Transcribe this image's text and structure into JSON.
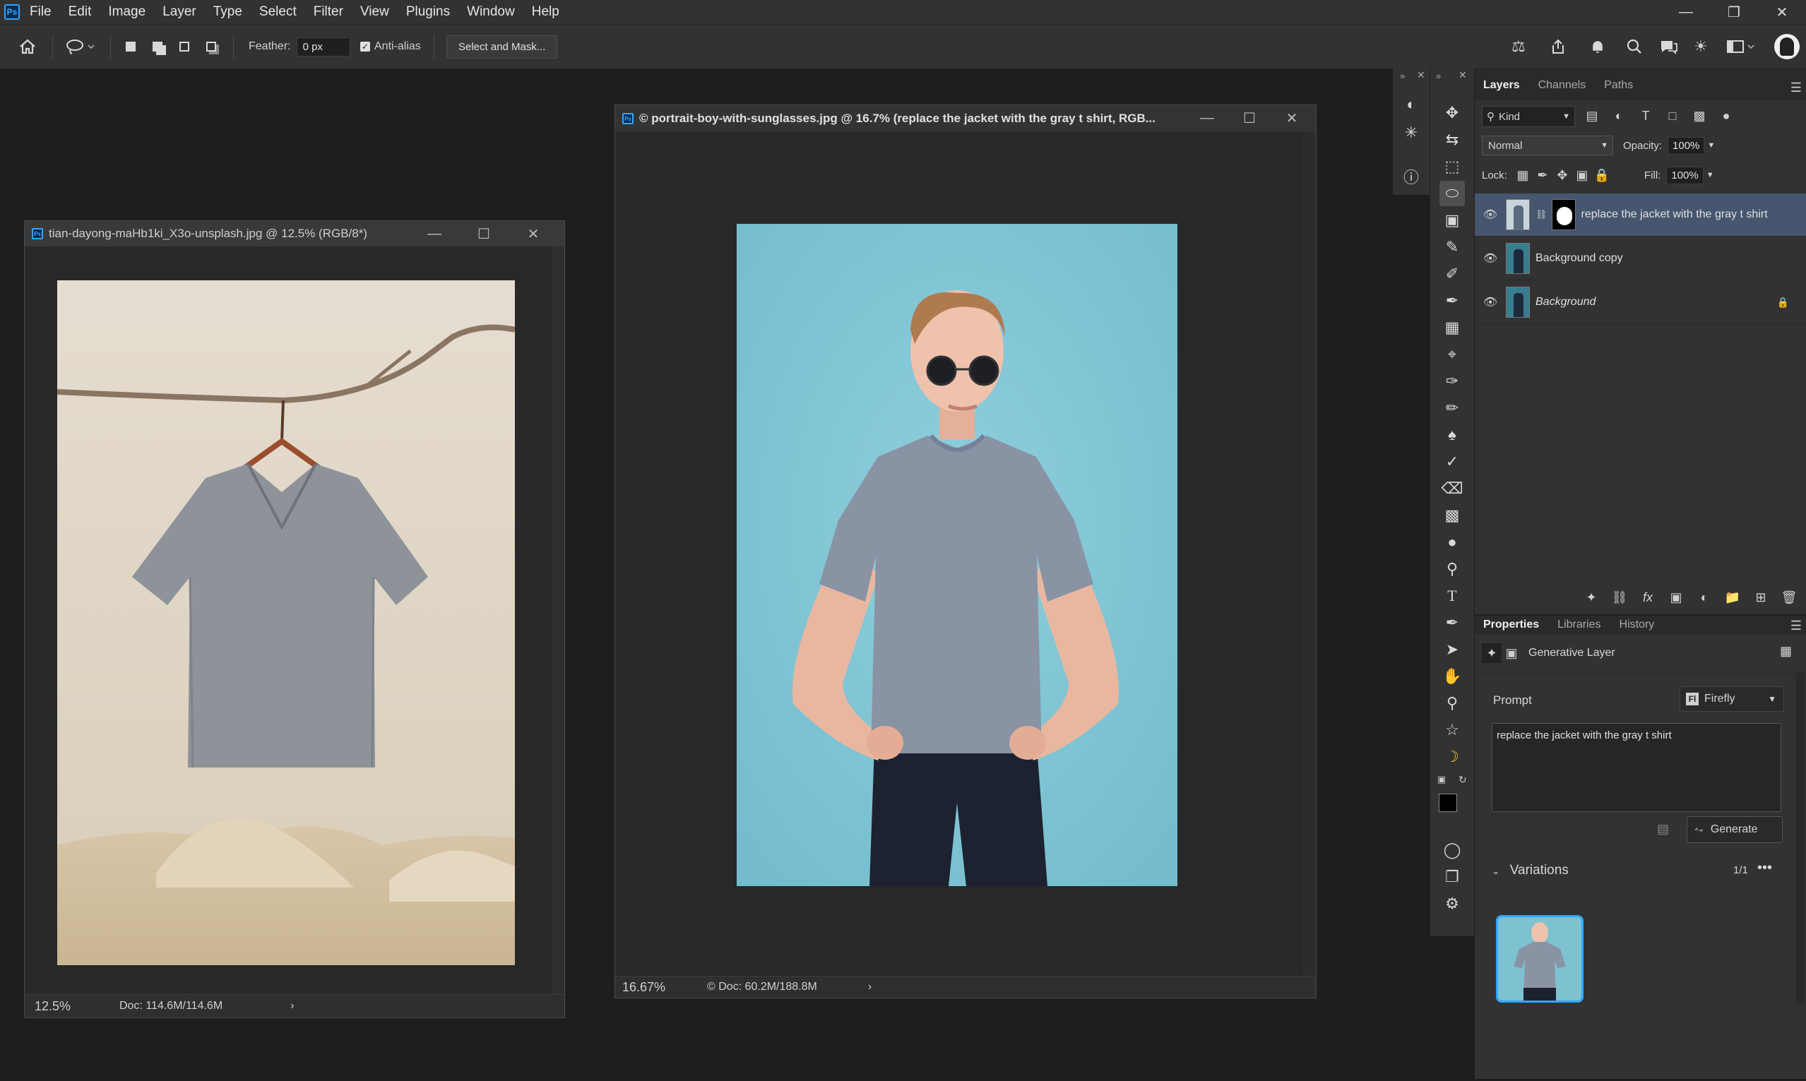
{
  "menubar": {
    "items": [
      "File",
      "Edit",
      "Image",
      "Layer",
      "Type",
      "Select",
      "Filter",
      "View",
      "Plugins",
      "Window",
      "Help"
    ]
  },
  "options": {
    "feather_label": "Feather:",
    "feather_value": "0 px",
    "antialias_label": "Anti-alias",
    "antialias_checked": true,
    "select_mask_label": "Select and Mask..."
  },
  "doc_left": {
    "title": "tian-dayong-maHb1ki_X3o-unsplash.jpg @ 12.5% (RGB/8*)",
    "zoom": "12.5%",
    "doc_info": "Doc: 114.6M/114.6M"
  },
  "doc_right": {
    "title": "© portrait-boy-with-sunglasses.jpg @ 16.7% (replace the jacket with the gray t shirt, RGB...",
    "zoom": "16.67%",
    "doc_info": "© Doc: 60.2M/188.8M"
  },
  "layers_panel": {
    "tabs": [
      "Layers",
      "Channels",
      "Paths"
    ],
    "kind_label": "Kind",
    "blend_mode": "Normal",
    "opacity_label": "Opacity:",
    "opacity_value": "100%",
    "lock_label": "Lock:",
    "fill_label": "Fill:",
    "fill_value": "100%",
    "layers": [
      {
        "name": "replace the jacket with the gray t shirt",
        "selected": true
      },
      {
        "name": "Background copy",
        "selected": false
      },
      {
        "name": "Background",
        "selected": false,
        "locked": true
      }
    ]
  },
  "properties_panel": {
    "tabs": [
      "Properties",
      "Libraries",
      "History"
    ],
    "layer_type": "Generative Layer",
    "prompt_label": "Prompt",
    "model_label": "Firefly",
    "prompt_text": "replace the jacket with the gray t shirt",
    "generate_label": "Generate",
    "variations_label": "Variations",
    "variations_count": "1/1"
  },
  "colors": {
    "accent": "#31a8ff",
    "panel_bg": "#323232",
    "selection_bg": "#45566e",
    "canvas_sky": "#7ec2d2"
  }
}
